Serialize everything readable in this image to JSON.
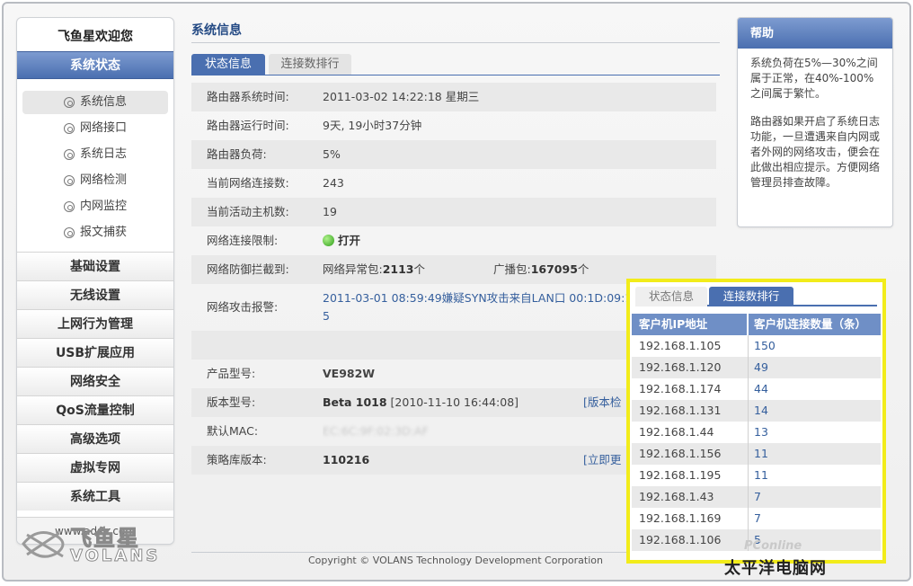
{
  "sidebar": {
    "welcome": "飞鱼星欢迎您",
    "active_section": "系统状态",
    "sub_items": [
      {
        "label": "系统信息",
        "selected": true
      },
      {
        "label": "网络接口",
        "selected": false
      },
      {
        "label": "系统日志",
        "selected": false
      },
      {
        "label": "网络检测",
        "selected": false
      },
      {
        "label": "内网监控",
        "selected": false
      },
      {
        "label": "报文捕获",
        "selected": false
      }
    ],
    "menu_items": [
      "基础设置",
      "无线设置",
      "上网行为管理",
      "USB扩展应用",
      "网络安全",
      "QoS流量控制",
      "高级选项",
      "虚拟专网",
      "系统工具"
    ],
    "url": "www.adslr.com"
  },
  "logo": {
    "cn": "飞鱼星",
    "en": "VOLANS"
  },
  "main": {
    "title": "系统信息",
    "tabs": [
      "状态信息",
      "连接数排行"
    ],
    "rows": [
      {
        "label": "路由器系统时间:",
        "value": "2011-03-02 14:22:18 星期三"
      },
      {
        "label": "路由器运行时间:",
        "value": "9天, 19小时37分钟"
      },
      {
        "label": "路由器负荷:",
        "value": "5%"
      },
      {
        "label": "当前网络连接数:",
        "value": "243"
      },
      {
        "label": "当前活动主机数:",
        "value": "19"
      },
      {
        "label": "网络连接限制:",
        "value": "打开"
      },
      {
        "label": "网络防御拦截到:",
        "abnormal_label": "网络异常包:",
        "abnormal_value": "2113",
        "unit": "个",
        "broadcast_label": "广播包:",
        "broadcast_value": "167095"
      },
      {
        "label": "网络攻击报警:",
        "value": "2011-03-01 08:59:49嫌疑SYN攻击来自LAN口 00:1D:09:15:8",
        "value2": "5"
      },
      {
        "label": "产品型号:",
        "value": "VE982W"
      },
      {
        "label": "版本型号:",
        "value_bold": "Beta 1018",
        "value_rest": " [2010-11-10 16:44:08]",
        "link": "[版本检"
      },
      {
        "label": "默认MAC:",
        "value": "EC:6C:9F:02:3D:AF"
      },
      {
        "label": "策略库版本:",
        "value": "110216",
        "link": "[立即更"
      }
    ],
    "footer": "Copyright © VOLANS Technology Development Corporation"
  },
  "help": {
    "title": "帮助",
    "p1": "系统负荷在5%—30%之间属于正常，在40%-100%之间属于繁忙。",
    "p2": "路由器如果开启了系统日志功能，一旦遭遇来自内网或者外网的网络攻击，便会在此做出相应提示。方便网络管理员排查故障。"
  },
  "overlay": {
    "tabs": [
      "状态信息",
      "连接数排行"
    ],
    "headers": [
      "客户机IP地址",
      "客户机连接数量（条）"
    ],
    "rows": [
      {
        "ip": "192.168.1.105",
        "count": "150"
      },
      {
        "ip": "192.168.1.120",
        "count": "49"
      },
      {
        "ip": "192.168.1.174",
        "count": "44"
      },
      {
        "ip": "192.168.1.131",
        "count": "14"
      },
      {
        "ip": "192.168.1.44",
        "count": "13"
      },
      {
        "ip": "192.168.1.156",
        "count": "11"
      },
      {
        "ip": "192.168.1.195",
        "count": "11"
      },
      {
        "ip": "192.168.1.43",
        "count": "7"
      },
      {
        "ip": "192.168.1.169",
        "count": "7"
      },
      {
        "ip": "192.168.1.106",
        "count": "5"
      }
    ],
    "highlight_color": "#f2ec1a"
  },
  "watermark": {
    "line1": "PConline",
    "line2": "太平洋电脑网"
  },
  "colors": {
    "accent": "#4a6fb0",
    "link": "#355f9d",
    "highlight": "#f2ec1a"
  }
}
